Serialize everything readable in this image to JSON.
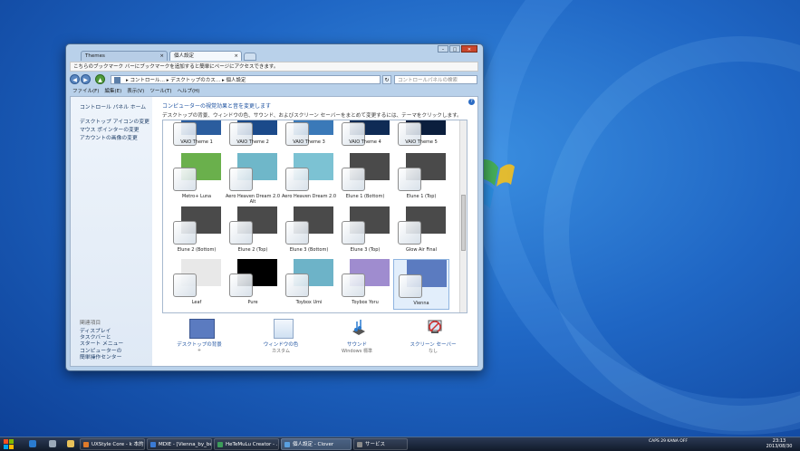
{
  "tabs": [
    {
      "label": "Themes"
    },
    {
      "label": "個人設定"
    }
  ],
  "window_controls": {
    "minimize": "–",
    "maximize": "□",
    "close": "✕"
  },
  "bookmark_bar": {
    "text": "こちらのブックマーク バーにブックマークを追加すると簡単にページにアクセスできます。"
  },
  "address_bar": {
    "path": "▸ コントロール… ▸ デスクトップのカス… ▸ 個人設定"
  },
  "search": {
    "placeholder": "コントロールパネルの検索"
  },
  "menu": [
    {
      "label": "ファイル(F)"
    },
    {
      "label": "編集(E)"
    },
    {
      "label": "表示(V)"
    },
    {
      "label": "ツール(T)"
    },
    {
      "label": "ヘルプ(H)"
    }
  ],
  "sidebar": {
    "home": "コントロール パネル ホーム",
    "links": [
      "デスクトップ アイコンの変更",
      "マウス ポインターの変更",
      "アカウントの画像の変更"
    ],
    "related_title": "関連項目",
    "related": [
      "ディスプレイ",
      "タスクバーと\nスタート メニュー",
      "コンピューターの\n簡単操作センター"
    ]
  },
  "main": {
    "heading": "コンピューターの視覚効果と音を変更します",
    "subheading": "デスクトップの背景、ウィンドウの色、サウンド、およびスクリーン セーバーをまとめて変更するには、テーマをクリックします。"
  },
  "themes": [
    {
      "name": "VAIO Theme 1",
      "bg": "#2b5d9e"
    },
    {
      "name": "VAIO Theme 2",
      "bg": "#1b4a8a"
    },
    {
      "name": "VAIO Theme 3",
      "bg": "#3a79b8"
    },
    {
      "name": "VAIO Theme 4",
      "bg": "#0f2b55"
    },
    {
      "name": "VAIO Theme 5",
      "bg": "#0b1e3d"
    },
    {
      "name": "Metro+ Luna",
      "bg": "#6ab04c"
    },
    {
      "name": "Aero Heaven Dream 2.0 Alt",
      "bg": "#6fb7c9"
    },
    {
      "name": "Aero Heaven Dream 2.0",
      "bg": "#7cc2d3"
    },
    {
      "name": "Elune 1 (Bottom)",
      "bg": "#4a4a4a"
    },
    {
      "name": "Elune 1 (Top)",
      "bg": "#4a4a4a"
    },
    {
      "name": "Elune 2 (Bottom)",
      "bg": "#4a4a4a"
    },
    {
      "name": "Elune 2 (Top)",
      "bg": "#4a4a4a"
    },
    {
      "name": "Elune 3 (Bottom)",
      "bg": "#4a4a4a"
    },
    {
      "name": "Elune 3 (Top)",
      "bg": "#4a4a4a"
    },
    {
      "name": "Glow Air Final",
      "bg": "#4a4a4a"
    },
    {
      "name": "Leaf",
      "bg": "#e8e8e8"
    },
    {
      "name": "Pure",
      "bg": "#000000"
    },
    {
      "name": "Toybox Umi",
      "bg": "#6db3c8"
    },
    {
      "name": "Toybox Yoru",
      "bg": "#9f8ccf"
    },
    {
      "name": "Vienna",
      "bg": "#5b7bc0"
    }
  ],
  "bottom_items": [
    {
      "label": "デスクトップの背景",
      "sub": "+",
      "icon": "desktop-background-icon"
    },
    {
      "label": "ウィンドウの色",
      "sub": "カスタム",
      "icon": "window-color-icon"
    },
    {
      "label": "サウンド",
      "sub": "Windows 標準",
      "icon": "sound-icon"
    },
    {
      "label": "スクリーン セーバー",
      "sub": "なし",
      "icon": "screensaver-icon"
    }
  ],
  "taskbar": {
    "items": [
      {
        "label": "UXStyle Core - k 本的…",
        "color": "#e07b2a"
      },
      {
        "label": "MDIE - [Vienna_by_be…",
        "color": "#3a7bd5"
      },
      {
        "label": "HeTeMuLu Creator - …",
        "color": "#3c9c5a"
      },
      {
        "label": "個人設定 - Clover",
        "color": "#5aa0e0"
      },
      {
        "label": "サービス",
        "color": "#8a8a8a"
      }
    ],
    "tray_text": "CAPS 29  KANA OFF",
    "time": "23:13",
    "date": "2013/08/30"
  },
  "colors": {
    "accent": "#1e52a0",
    "selected_bg": "#e2eefb"
  }
}
